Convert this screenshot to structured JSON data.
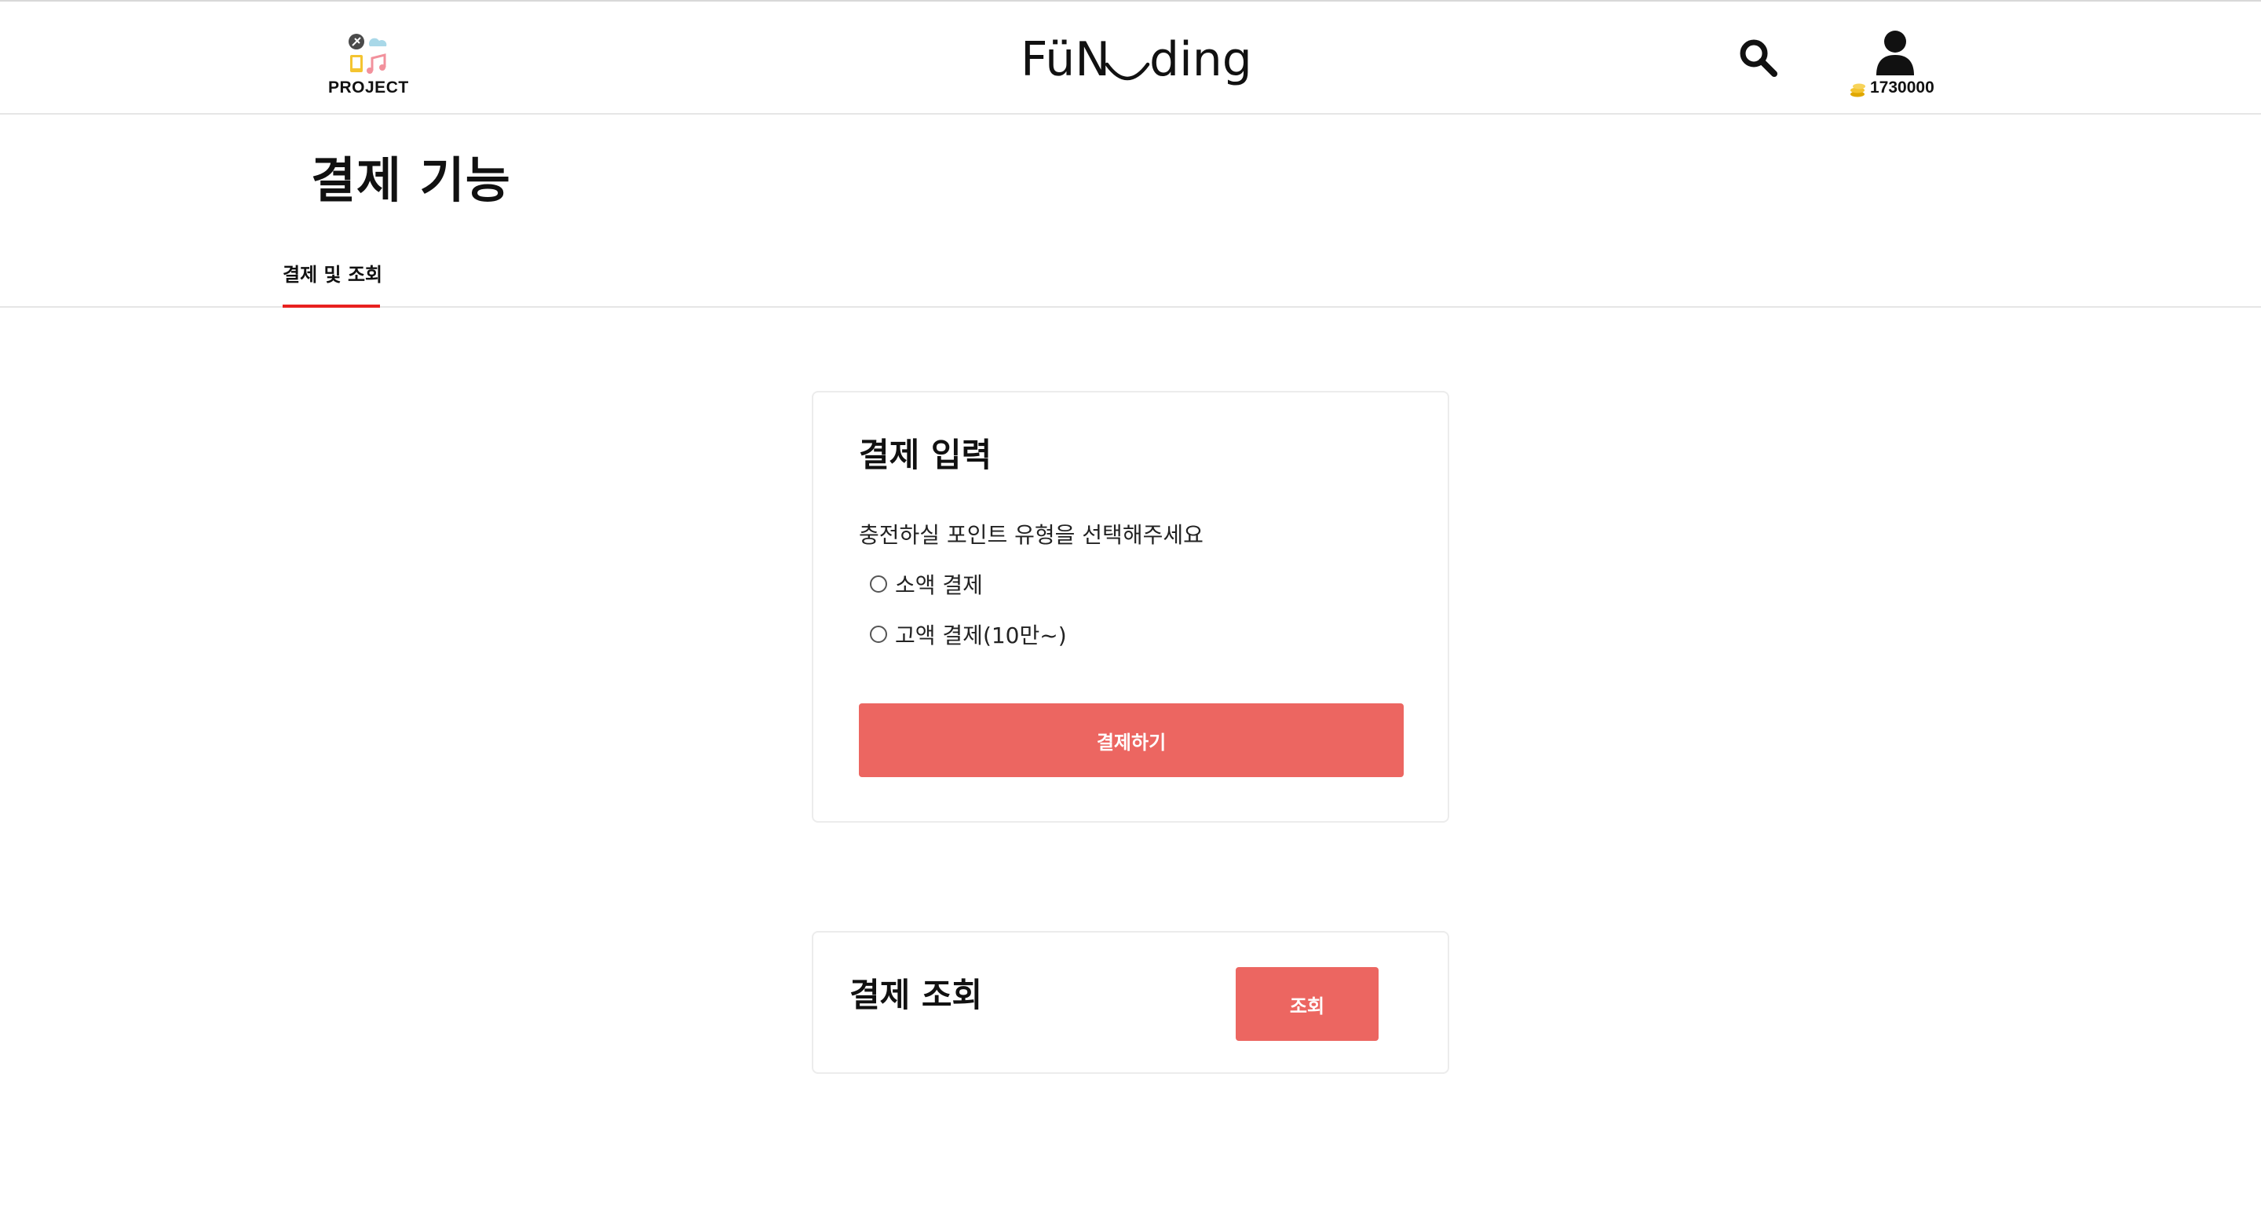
{
  "header": {
    "project_label": "PROJECT",
    "logo_left": "FüN",
    "logo_right": "ding",
    "balance": "1730000",
    "icons": {
      "project": "project-category-icon",
      "search": "search-icon",
      "user": "user-icon",
      "coin": "coin-icon"
    }
  },
  "page": {
    "title": "결제 기능",
    "tabs": [
      {
        "label": "결제 및 조회",
        "active": true
      }
    ]
  },
  "payment": {
    "title": "결제 입력",
    "prompt": "충전하실 포인트 유형을 선택해주세요",
    "options": [
      {
        "label": "소액 결제",
        "checked": false
      },
      {
        "label": "고액 결제(10만~)",
        "checked": false
      }
    ],
    "submit_label": "결제하기"
  },
  "query": {
    "title": "결제 조회",
    "button_label": "조회"
  },
  "colors": {
    "accent": "#ec6661",
    "tab_underline": "#e8211f",
    "coin": "#f4c430"
  }
}
